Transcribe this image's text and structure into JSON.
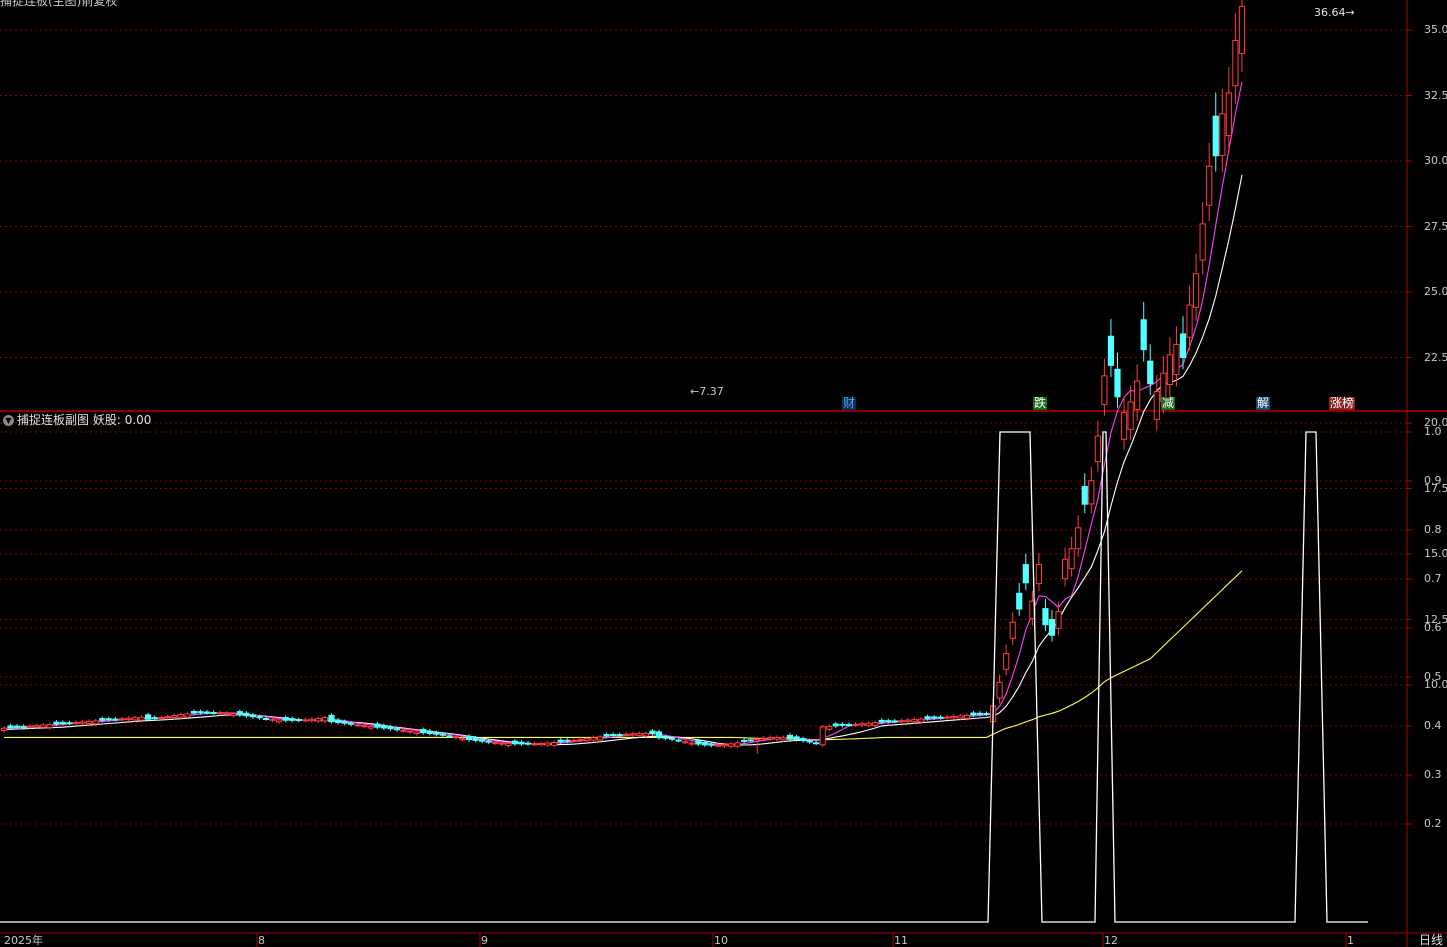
{
  "main_panel": {
    "title_partial": "捕捉连板(主图)前复权",
    "high_label": "36.64",
    "low_label": "7.37",
    "y_ticks": [
      "35.0",
      "32.5",
      "30.0",
      "27.5",
      "25.0",
      "22.5",
      "20.0",
      "17.5",
      "15.0",
      "12.5",
      "10.0"
    ],
    "event_tags": [
      {
        "text": "财",
        "color": "#4aa3ff",
        "bg": "#102a4a"
      },
      {
        "text": "跌",
        "color": "#ffffff",
        "bg": "#1a6b1a"
      },
      {
        "text": "减",
        "color": "#ffffff",
        "bg": "#1a6b1a"
      },
      {
        "text": "解",
        "color": "#ffffff",
        "bg": "#1a4a6b"
      },
      {
        "text": "涨榜",
        "color": "#ffffff",
        "bg": "#8b2020"
      }
    ]
  },
  "sub_panel": {
    "indicator_name": "捕捉连板副图",
    "value_label": "妖股: 0.00",
    "y_ticks": [
      "1.0",
      "0.9",
      "0.8",
      "0.7",
      "0.6",
      "0.5",
      "0.4",
      "0.3",
      "0.2"
    ]
  },
  "x_axis": {
    "labels": [
      "2025年",
      "8",
      "9",
      "10",
      "11",
      "12",
      "1"
    ]
  },
  "period_label": "日线",
  "colors": {
    "up": "#ff3b3b",
    "down": "#54ffff",
    "ma5": "#ffffff",
    "ma10": "#ff40ff",
    "ma60": "#ffff40",
    "grid": "#8b0000",
    "frame": "#b00000"
  },
  "chart_data": {
    "type": "candlestick",
    "price_axis": {
      "min": 7.37,
      "max": 36.64
    },
    "high_point": 36.64,
    "low_point": 7.37,
    "indicator_series": {
      "name": "妖股",
      "ylim": [
        0,
        1.0
      ],
      "pulses": [
        {
          "segment": "late-November",
          "value": 1.0
        },
        {
          "segment": "early-December",
          "value": 1.0
        },
        {
          "segment": "late-December",
          "value": 1.0
        }
      ]
    }
  }
}
